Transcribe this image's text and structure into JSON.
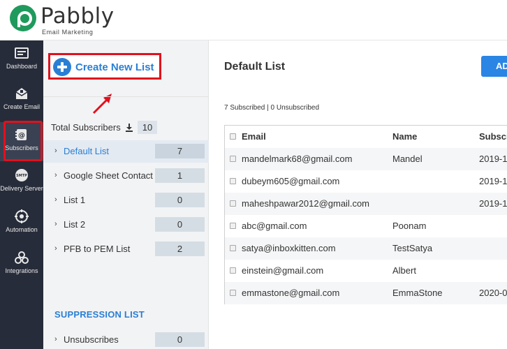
{
  "brand": {
    "name": "Pabbly",
    "tagline": "Email Marketing"
  },
  "nav": {
    "items": [
      {
        "label": "Dashboard",
        "icon": "dashboard-icon"
      },
      {
        "label": "Create Email",
        "icon": "create-email-icon"
      },
      {
        "label": "Subscribers",
        "icon": "subscribers-icon"
      },
      {
        "label": "Delivery Server",
        "icon": "smtp-icon",
        "icon_text": "SMTP"
      },
      {
        "label": "Automation",
        "icon": "automation-icon"
      },
      {
        "label": "Integrations",
        "icon": "integrations-icon"
      }
    ],
    "active": "Subscribers"
  },
  "lists": {
    "create_label": "Create New List",
    "total_label": "Total Subscribers",
    "total_count": "10",
    "items": [
      {
        "name": "Default List",
        "count": "7"
      },
      {
        "name": "Google Sheet Contact",
        "count": "1"
      },
      {
        "name": "List 1",
        "count": "0"
      },
      {
        "name": "List 2",
        "count": "0"
      },
      {
        "name": "PFB to PEM List",
        "count": "2"
      }
    ],
    "suppression_title": "SUPPRESSION LIST",
    "suppression_items": [
      {
        "name": "Unsubscribes",
        "count": "0"
      }
    ]
  },
  "main": {
    "title": "Default List",
    "add_button": "AD",
    "summary": "7 Subscribed | 0 Unsubscribed",
    "columns": [
      "Email",
      "Name",
      "Subscr"
    ],
    "rows": [
      {
        "email": "mandelmark68@gmail.com",
        "name": "Mandel",
        "date": "2019-1"
      },
      {
        "email": "dubeym605@gmail.com",
        "name": "",
        "date": "2019-1"
      },
      {
        "email": "maheshpawar2012@gmail.com",
        "name": "",
        "date": "2019-1"
      },
      {
        "email": "abc@gmail.com",
        "name": "Poonam",
        "date": ""
      },
      {
        "email": "satya@inboxkitten.com",
        "name": "TestSatya",
        "date": ""
      },
      {
        "email": "einstein@gmail.com",
        "name": "Albert",
        "date": ""
      },
      {
        "email": "emmastone@gmail.com",
        "name": "EmmaStone",
        "date": "2020-0"
      }
    ]
  },
  "colors": {
    "accent": "#2a7fd4",
    "highlight": "#e0111d",
    "nav_bg": "#272c3a",
    "brand_green": "#1f9a5c"
  }
}
